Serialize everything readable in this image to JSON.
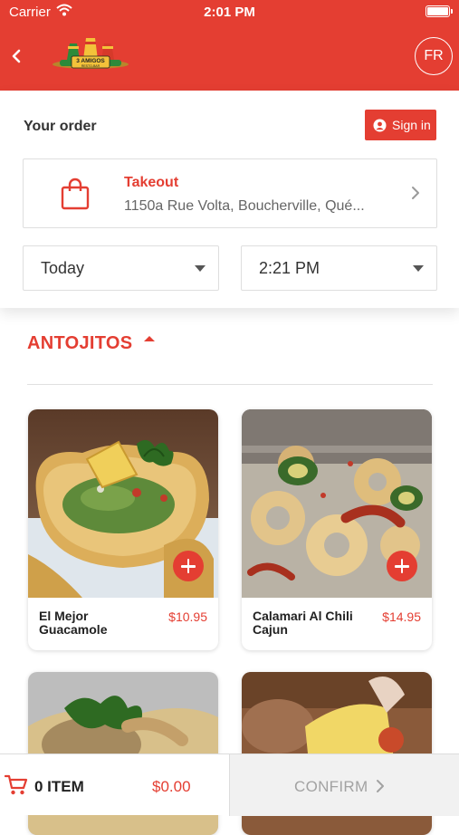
{
  "status_bar": {
    "carrier": "Carrier",
    "time": "2:01 PM"
  },
  "header": {
    "logo_text": "3 AMIGOS",
    "logo_subtext": "RESTO-BAR",
    "language_button": "FR",
    "brand_color": "#e43e32"
  },
  "order": {
    "title": "Your order",
    "sign_in_label": "Sign in",
    "mode_label": "Takeout",
    "address": "1150a Rue Volta, Boucherville, Qué...",
    "day_value": "Today",
    "time_value": "2:21 PM"
  },
  "menu": {
    "category_title": "ANTOJITOS",
    "products": [
      {
        "name": "El Mejor Guacamole",
        "price": "$10.95"
      },
      {
        "name": "Calamari Al Chili Cajun",
        "price": "$14.95"
      },
      {
        "name": "",
        "price": ""
      },
      {
        "name": "",
        "price": ""
      }
    ]
  },
  "cart": {
    "count_label": "0 ITEM",
    "total": "$0.00",
    "confirm_label": "CONFIRM"
  },
  "icons": [
    "back-icon",
    "wifi-icon",
    "battery-icon",
    "account-icon",
    "shopping-bag-icon",
    "chevron-right-icon",
    "dropdown-arrow-icon",
    "collapse-caret-icon",
    "plus-icon",
    "cart-icon"
  ]
}
